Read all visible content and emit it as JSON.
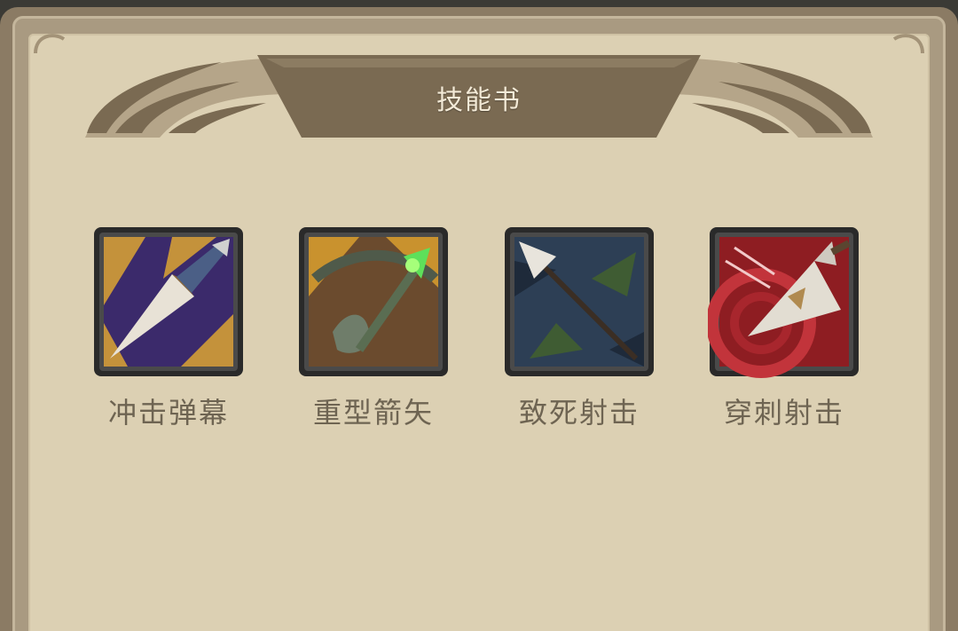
{
  "panel": {
    "title": "技能书"
  },
  "skills": [
    {
      "name": "冲击弹幕",
      "icon": "piercing-spear-icon",
      "accent": "#3b2a6b"
    },
    {
      "name": "重型箭矢",
      "icon": "heavy-crossbow-icon",
      "accent": "#c9922e"
    },
    {
      "name": "致死射击",
      "icon": "deadly-arrow-icon",
      "accent": "#2d3f55"
    },
    {
      "name": "穿刺射击",
      "icon": "piercing-shot-icon",
      "accent": "#8e1d22"
    }
  ],
  "colors": {
    "frame": "#8b7b64",
    "parchment": "#dcd0b3",
    "header_band": "#7a6a52",
    "title_text": "#f3ead7",
    "label_text": "#6e6452"
  }
}
